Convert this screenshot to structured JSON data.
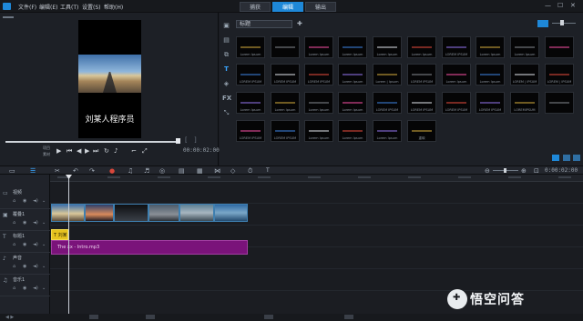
{
  "titlebar": {
    "menus": [
      "文件(F)",
      "编辑(E)",
      "工具(T)",
      "设置(S)",
      "帮助(H)"
    ],
    "tabs": [
      "捕获",
      "编辑",
      "输出"
    ],
    "active_tab": "编辑"
  },
  "player": {
    "caption": "刘某人程序员",
    "timecode": "00:00:02:00",
    "mode_top": "项目",
    "mode_bottom": "素材"
  },
  "library": {
    "dropdown": "标题",
    "thumbnails": [
      "Lorem Ipsum",
      "",
      "Lorem Ipsum",
      "Lorem Ipsum",
      "Lorem Ipsum",
      "Lorem Ipsum",
      "LOREM IPSUM",
      "Lorem Ipsum",
      "Lorem Ipsum",
      "",
      "LOREM IPSUM",
      "LOREM IPSUM",
      "LOREM IPSUM",
      "Lorem Ipsum",
      "Lorem | Ipsum",
      "LOREM IPSUM",
      "Lorem Ipsum",
      "Lorem Ipsum",
      "LOREM | IPSUM",
      "LOREM | IPSUM",
      "Lorem Ipsum",
      "Lorem Ipsum",
      "Lorem Ipsum",
      "Lorem Ipsum",
      "LOREM IPSUM",
      "LOREM IPSUM",
      "LOREM IPSUM",
      "LOREM IPSUM",
      "LOREMIPSUM",
      "",
      "LOREM IPSUM",
      "LOREM IPSUM",
      "Lorem Ipsum",
      "Lorem Ipsum",
      "Lorem Ipsum",
      "重映"
    ]
  },
  "timeline": {
    "timecode": "0:00:02:00",
    "tracks": [
      {
        "name": "视频"
      },
      {
        "name": "覆叠1"
      },
      {
        "name": "标题1"
      },
      {
        "name": "声音"
      },
      {
        "name": "音乐1"
      }
    ],
    "title_clip": "T 刘某",
    "audio_clip": "The xx - Intro.mp3"
  },
  "watermark": "悟空问答",
  "colors": {
    "accent": "#1e88d8",
    "audio_clip": "#7a137a",
    "title_clip": "#e6c21f"
  }
}
